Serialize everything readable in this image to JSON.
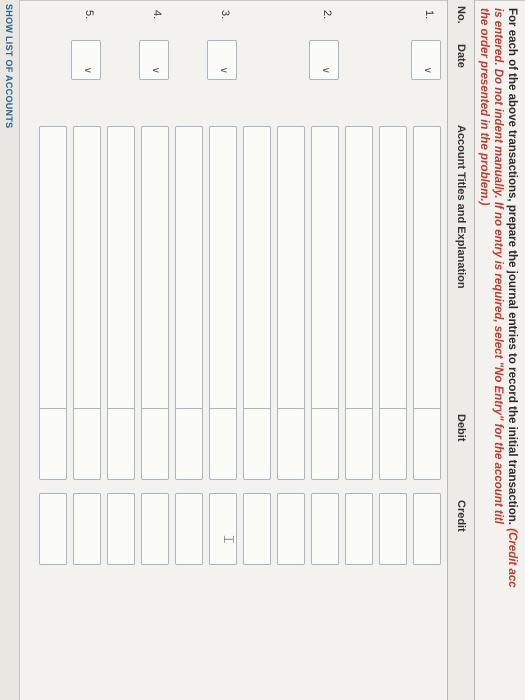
{
  "instruction": {
    "line1_plain": "For each of the above transactions, prepare the journal entries to record the initial transaction. ",
    "line1_red": "(Credit acc",
    "line2_red": "is entered. Do not indent manually. If no entry is required, select \"No Entry\" for the account titl",
    "line3_red": "the order presented in the problem.)"
  },
  "table": {
    "headers": {
      "no": "No.",
      "date": "Date",
      "account": "Account Titles and Explanation",
      "debit": "Debit",
      "credit": "Credit"
    },
    "entries": [
      {
        "no": "1."
      },
      {
        "no": "2."
      },
      {
        "no": "3."
      },
      {
        "no": "4."
      },
      {
        "no": "5."
      }
    ],
    "date_dropdown_icon": "chevron-down-icon"
  },
  "footer": {
    "show_accounts_label": "SHOW LIST OF ACCOUNTS"
  }
}
